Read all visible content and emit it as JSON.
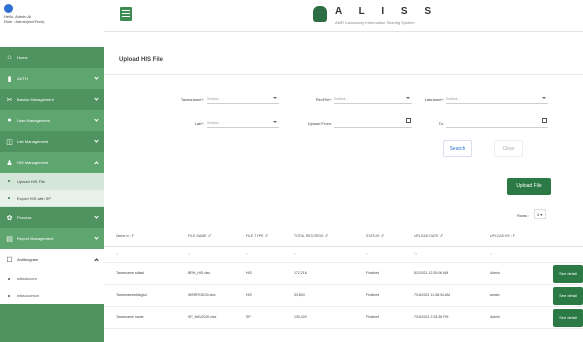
{
  "sidebar": {
    "greeting": "Hello, Admin Al",
    "role": "Role : Admin(me/Tech)",
    "items": [
      {
        "label": "Home",
        "icon": "home-icon",
        "glyph": "⌂"
      },
      {
        "label": "AUTH",
        "icon": "lock-icon",
        "glyph": "▮"
      },
      {
        "label": "Basion Management",
        "icon": "tools-icon",
        "glyph": "✂"
      },
      {
        "label": "User Management",
        "icon": "user-icon",
        "glyph": "●"
      },
      {
        "label": "Lab Management",
        "icon": "lab-icon",
        "glyph": "◫"
      },
      {
        "label": "HIS Management",
        "icon": "users-icon",
        "glyph": "♟"
      }
    ],
    "his_sub": [
      "Upload HIS File",
      "Export HIS with SP"
    ],
    "items2": [
      {
        "label": "Process",
        "icon": "gear-icon",
        "glyph": "✿"
      },
      {
        "label": "Report Management",
        "icon": "report-icon",
        "glyph": "▤"
      }
    ],
    "antibiogram": {
      "label": "Antibiogram",
      "icon": "document-icon",
      "glyph": "☐"
    },
    "antibiogram_sub": [
      "wiksdocom",
      "wiksocomon"
    ]
  },
  "header": {
    "brand": "A L I S S",
    "brand_sub": "AMR Laboratory Information Sharing System"
  },
  "page": {
    "title": "Upload HIS File",
    "filters": {
      "hospital_label": "Tavesname*:",
      "hospital_value": "Select...",
      "lab_label": "Lab*:",
      "lab_value": "Select...",
      "file_label": "RevFile*:",
      "file_value": "Select...",
      "upload_from_label": "Upload From:",
      "labname_label": "Labname*:",
      "labname_value": "Select...",
      "to_label": "To:"
    },
    "search_label": "Search",
    "clear_label": "Clear",
    "upload_label": "Upload File",
    "rows_label": "Rows :",
    "rows_value": "4 ▾"
  },
  "table": {
    "headers": [
      "Name in ↓F",
      "FILE NAME ↓F",
      "FILE TYPE ↓F",
      "TOTAL RECORDS ↓F",
      "STATUS ↓F",
      "UPLOAD DATE ↓F",
      "UPLOAD BY ↓F"
    ],
    "filters": [
      "∩",
      "∩",
      "∩",
      "∩",
      "∩",
      "⊓",
      "∩"
    ],
    "rows": [
      {
        "cells": [
          "Tavesname sdfasl",
          "BRH_HIS.xlsx",
          "HIS",
          "172,216",
          "Finished",
          "8/2/2021 12:30:06 AM",
          "Admin"
        ],
        "action": "See detail"
      },
      {
        "cells": [
          "Tavesnamesfdsyjsd",
          "WSRFEDDI3.xlsx",
          "HIS",
          "33,804",
          "Finished",
          "7/16/2021 11:38:34 AM",
          "amain"
        ],
        "action": "See detail"
      },
      {
        "cells": [
          "Tavesname name",
          "SP_NAV2020.xlsx",
          "SP",
          "130,420",
          "Finished",
          "7/15/2021 2:33:35 PM",
          "Admin"
        ],
        "action": "See detail"
      }
    ]
  },
  "colors": {
    "sidebar": "#4f9460",
    "accent": "#2b7a45",
    "link": "#2f6fd1"
  }
}
